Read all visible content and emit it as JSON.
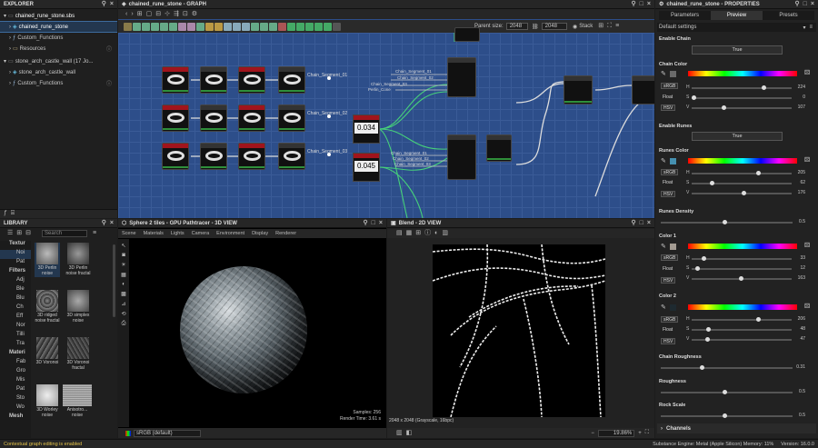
{
  "explorer": {
    "title": "EXPLORER",
    "items": [
      {
        "label": "chained_rune_stone.sbs"
      },
      {
        "label": "chained_rune_stone"
      },
      {
        "label": "Custom_Functions"
      },
      {
        "label": "Resources"
      },
      {
        "label": "stone_arch_castle_wall (17 Jo..."
      },
      {
        "label": "stone_arch_castle_wall"
      },
      {
        "label": "Custom_Functions"
      }
    ]
  },
  "graph": {
    "title": "chained_rune_stone - GRAPH",
    "parent_size_label": "Parent size:",
    "parent_size": "2048",
    "size": "2048",
    "stack_label": "Stack",
    "node_labels": [
      "Chain_Segment_01",
      "Chain_Segment_02",
      "Chain_Segment_03"
    ],
    "inputs": [
      "Chain_Segment_01",
      "Chain_Segment_02",
      "Chain_Segment_03",
      "Perlin_Cone",
      "Chain_Segment_01",
      "Chain_Segment_02",
      "Chain_Segment_03"
    ],
    "values": [
      "0.034",
      "0.045"
    ]
  },
  "library": {
    "title": "LIBRARY",
    "search_placeholder": "Search",
    "categories": [
      "Textur",
      "Noi",
      "Pat",
      "Filters",
      "Adj",
      "Ble",
      "Blu",
      "Ch",
      "Eff",
      "Nor",
      "Tilli",
      "Tra",
      "Materi",
      "Fab",
      "Gro",
      "Mis",
      "Pat",
      "Sto",
      "Wo",
      "Mesh"
    ],
    "items": [
      {
        "label": "3D Perlin noise"
      },
      {
        "label": "3D Perlin noise fractal"
      },
      {
        "label": "3D ridged noise fractal"
      },
      {
        "label": "3D simplex noise"
      },
      {
        "label": "3D Voronoi"
      },
      {
        "label": "3D Voronoi fractal"
      },
      {
        "label": "3D Worley noise"
      },
      {
        "label": "Anisotro... noise"
      }
    ]
  },
  "view3d": {
    "title": "Sphere 2 tiles - GPU Pathtracer - 3D VIEW",
    "menu": [
      "Scene",
      "Materials",
      "Lights",
      "Camera",
      "Environment",
      "Display",
      "Renderer"
    ],
    "samples": "Samples: 256",
    "render_time": "Render Time: 3.61 s",
    "colorspace": "sRGB (default)"
  },
  "view2d": {
    "title": "Blend - 2D VIEW",
    "info": "2048 x 2048 (Grayscale, 16bpc)",
    "zoom": "19.86%"
  },
  "properties": {
    "title": "chained_rune_stone - PROPERTIES",
    "tabs": [
      "Parameters",
      "Preview",
      "Presets"
    ],
    "preset": "Default settings",
    "enable_chain_label": "Enable Chain",
    "enable_chain_value": "True",
    "chain_color_label": "Chain Color",
    "chain_color": {
      "h": "224",
      "s": "0",
      "v": "107"
    },
    "enable_runes_label": "Enable Runes",
    "enable_runes_value": "True",
    "runes_color_label": "Runes Color",
    "runes_color": {
      "h": "205",
      "s": "62",
      "v": "176"
    },
    "runes_density_label": "Runes Density",
    "runes_density": "0.5",
    "color1_label": "Color 1",
    "color1": {
      "h": "33",
      "s": "12",
      "v": "163"
    },
    "color2_label": "Color 2",
    "color2": {
      "h": "206",
      "s": "48",
      "v": "47"
    },
    "chain_roughness_label": "Chain Roughness",
    "chain_roughness": "0.31",
    "roughness_label": "Roughness",
    "roughness": "0.5",
    "rock_scale_label": "Rock Scale",
    "rock_scale": "0.5",
    "channels_label": "Channels",
    "mode_labels": [
      "sRGB",
      "Float",
      "HSV"
    ],
    "hsv_letters": [
      "H",
      "S",
      "V"
    ]
  },
  "status": {
    "left": "Contextual graph editing is enabled",
    "right": "Substance Engine: Metal (Apple Silicon)  Memory: 11%",
    "version": "Version: 16.0.0"
  }
}
